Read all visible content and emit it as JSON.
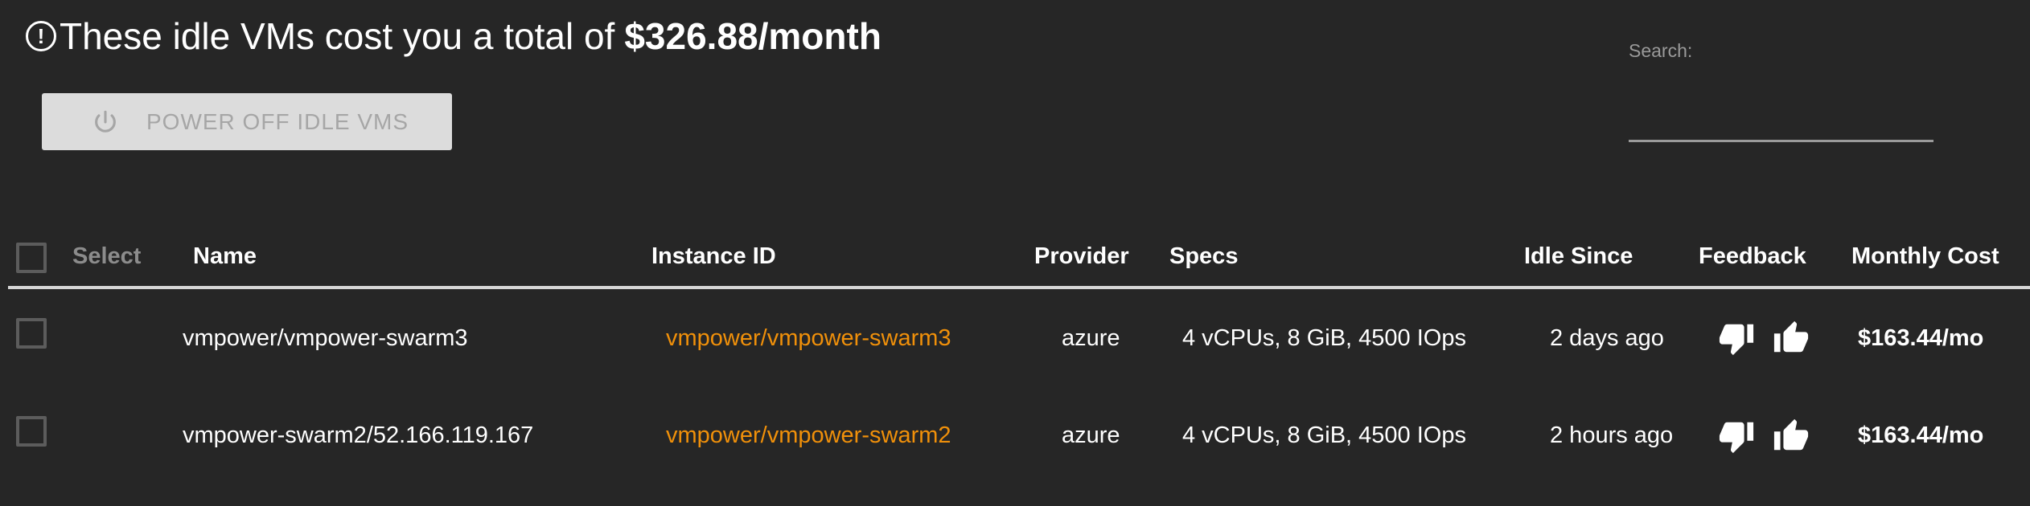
{
  "header": {
    "title_prefix": "These idle VMs cost you a total of",
    "title_total": "$326.88/month",
    "warning_icon": "alert-circle-icon"
  },
  "actions": {
    "power_off_label": "POWER OFF IDLE VMS",
    "power_icon": "power-icon"
  },
  "search": {
    "label": "Search:",
    "value": "",
    "placeholder": ""
  },
  "table": {
    "columns": [
      "Select",
      "Name",
      "Instance ID",
      "Provider",
      "Specs",
      "Idle Since",
      "Feedback",
      "Monthly Cost"
    ],
    "rows": [
      {
        "name": "vmpower/vmpower-swarm3",
        "instance_id": "vmpower/vmpower-swarm3",
        "provider": "azure",
        "specs": "4 vCPUs, 8 GiB, 4500 IOps",
        "idle_since": "2 days ago",
        "monthly_cost": "$163.44/mo",
        "selected": false
      },
      {
        "name": "vmpower-swarm2/52.166.119.167",
        "instance_id": "vmpower/vmpower-swarm2",
        "provider": "azure",
        "specs": "4 vCPUs, 8 GiB, 4500 IOps",
        "idle_since": "2 hours ago",
        "monthly_cost": "$163.44/mo",
        "selected": false
      }
    ]
  },
  "colors": {
    "background": "#262626",
    "link": "#f0900a",
    "button_bg": "#dcdcdc",
    "button_text": "#a6a6a6"
  }
}
